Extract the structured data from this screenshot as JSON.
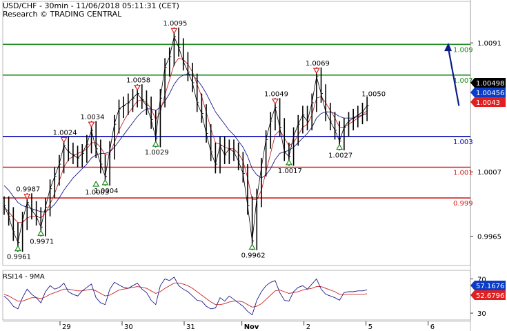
{
  "header": {
    "line1": "USD/CHF - 30min - 11/06/2018 05:11:31 (CET)",
    "line2": "Research © TRADING CENTRAL"
  },
  "rsi_title": "RSI14 - 9MA",
  "colors": {
    "price": "#000000",
    "ma_fast": "#cc2222",
    "ma_slow": "#1a1a8c",
    "resistance": "#1e8c1e",
    "pivot": "#0000b4",
    "support": "#d42020",
    "arrow": "#0a1e8c",
    "peak_marker": "#d42020",
    "trough_marker": "#1e8c1e",
    "tag_black": "#000000",
    "tag_blue": "#0a3cc8",
    "tag_red": "#e02020"
  },
  "chart_data": [
    {
      "type": "line",
      "name": "price",
      "x_ticks": [
        {
          "label": "29",
          "pos": 0.9
        },
        {
          "label": "30",
          "pos": 1.9
        },
        {
          "label": "31",
          "pos": 2.9
        },
        {
          "label": "Nov",
          "pos": 3.83
        },
        {
          "label": "2",
          "pos": 4.83
        },
        {
          "label": "5",
          "pos": 5.83
        },
        {
          "label": "6",
          "pos": 6.83
        }
      ],
      "ylim": [
        0.9946,
        1.0118
      ],
      "y_ticks": [
        "1.0091",
        "1.0007",
        "0.9965"
      ],
      "levels": [
        {
          "label": "1.009",
          "value": 1.009,
          "kind": "resistance"
        },
        {
          "label": "1.007",
          "value": 1.007,
          "kind": "resistance"
        },
        {
          "label": "1.003",
          "value": 1.003,
          "kind": "pivot"
        },
        {
          "label": "1.001",
          "value": 1.001,
          "kind": "support"
        },
        {
          "label": "0.999",
          "value": 0.999,
          "kind": "support"
        }
      ],
      "price_tags": [
        {
          "label": "1.00498",
          "value": 1.00498,
          "style": "black"
        },
        {
          "label": "1.00456",
          "value": 1.00456,
          "style": "blue"
        },
        {
          "label": "1.0043",
          "value": 1.0043,
          "style": "red"
        }
      ],
      "series": {
        "x": [
          0.0,
          0.1,
          0.2,
          0.3,
          0.4,
          0.5,
          0.6,
          0.7,
          0.8,
          0.9,
          1.0,
          1.1,
          1.2,
          1.3,
          1.4,
          1.5,
          1.6,
          1.7,
          1.8,
          1.9,
          2.0,
          2.1,
          2.2,
          2.3,
          2.4,
          2.5,
          2.6,
          2.7,
          2.8,
          2.9,
          3.0,
          3.1,
          3.2,
          3.3,
          3.4,
          3.5,
          3.6,
          3.7,
          3.8,
          3.9,
          4.0,
          4.1,
          4.2,
          4.3,
          4.4,
          4.5,
          4.6,
          4.7,
          4.8,
          4.9,
          5.0,
          5.1,
          5.2,
          5.3,
          5.4,
          5.5,
          5.6,
          5.7,
          5.8,
          5.9,
          6.0,
          6.1,
          6.2,
          6.3,
          6.4,
          6.5,
          6.6,
          6.7,
          6.8,
          6.9,
          7.0,
          7.1,
          7.2,
          7.3,
          7.4,
          7.5,
          7.6,
          7.7,
          7.8,
          7.9,
          8.0,
          8.1,
          8.2,
          8.3,
          8.4,
          8.5,
          8.6,
          8.7,
          8.8,
          8.9,
          9.0,
          9.1,
          9.2,
          9.3,
          9.4,
          9.5,
          9.6,
          9.7,
          9.8,
          9.9
        ],
        "close": [
          0.9985,
          0.9978,
          0.9968,
          0.9961,
          0.9975,
          0.9987,
          0.9982,
          0.9978,
          0.9971,
          0.9984,
          0.9996,
          1.0004,
          1.0012,
          1.0024,
          1.002,
          1.0018,
          1.0016,
          1.0019,
          1.0025,
          1.0034,
          1.0022,
          1.0012,
          1.0004,
          1.0021,
          1.0038,
          1.0048,
          1.005,
          1.0052,
          1.0055,
          1.0058,
          1.0054,
          1.005,
          1.0041,
          1.0029,
          1.0055,
          1.0075,
          1.0082,
          1.0095,
          1.0088,
          1.0079,
          1.0072,
          1.0065,
          1.0052,
          1.0045,
          1.0032,
          1.002,
          1.0012,
          1.0024,
          1.0018,
          1.0022,
          1.002,
          1.0014,
          1.0006,
          0.9985,
          0.9962,
          0.999,
          1.001,
          1.0028,
          1.004,
          1.0049,
          1.0036,
          1.002,
          1.0017,
          1.003,
          1.0038,
          1.0044,
          1.004,
          1.0052,
          1.0069,
          1.0058,
          1.0046,
          1.004,
          1.0034,
          1.0027,
          1.0036,
          1.004,
          1.0042,
          1.0044,
          1.0046,
          1.005
        ],
        "ma_fast": [
          0.9984,
          0.9981,
          0.9977,
          0.9974,
          0.9974,
          0.9977,
          0.9978,
          0.9978,
          0.9977,
          0.998,
          0.9986,
          0.9993,
          1.0001,
          1.001,
          1.0015,
          1.0017,
          1.0019,
          1.002,
          1.0022,
          1.0026,
          1.0026,
          1.0023,
          1.0018,
          1.0019,
          1.0026,
          1.0034,
          1.004,
          1.0045,
          1.0049,
          1.0053,
          1.0054,
          1.0052,
          1.0048,
          1.0041,
          1.0046,
          1.0057,
          1.0067,
          1.0077,
          1.0081,
          1.008,
          1.0077,
          1.0072,
          1.0064,
          1.0056,
          1.0046,
          1.0035,
          1.0026,
          1.0025,
          1.0023,
          1.0022,
          1.0022,
          1.0019,
          1.0014,
          1.0003,
          0.9989,
          0.9989,
          0.9995,
          1.0007,
          1.0019,
          1.0031,
          1.0034,
          1.0029,
          1.0024,
          1.0026,
          1.0031,
          1.0036,
          1.0038,
          1.0044,
          1.0055,
          1.0056,
          1.0052,
          1.0047,
          1.0042,
          1.0036,
          1.0036,
          1.0038,
          1.004,
          1.0042,
          1.0044,
          1.0047
        ],
        "ma_slow": [
          0.9998,
          0.9995,
          0.9991,
          0.9987,
          0.9985,
          0.9984,
          0.9983,
          0.9982,
          0.9981,
          0.9981,
          0.9983,
          0.9986,
          0.999,
          0.9995,
          0.9999,
          1.0003,
          1.0006,
          1.0009,
          1.0012,
          1.0016,
          1.0018,
          1.0019,
          1.0019,
          1.002,
          1.0023,
          1.0027,
          1.0031,
          1.0035,
          1.0039,
          1.0043,
          1.0046,
          1.0048,
          1.0048,
          1.0047,
          1.0049,
          1.0053,
          1.0058,
          1.0064,
          1.0068,
          1.007,
          1.0071,
          1.007,
          1.0067,
          1.0063,
          1.0058,
          1.0052,
          1.0046,
          1.0042,
          1.0038,
          1.0034,
          1.0031,
          1.0027,
          1.0023,
          1.0017,
          1.0009,
          1.0005,
          1.0003,
          1.0005,
          1.0009,
          1.0015,
          1.0019,
          1.002,
          1.0021,
          1.0023,
          1.0026,
          1.0029,
          1.0032,
          1.0036,
          1.0042,
          1.0045,
          1.0046,
          1.0046,
          1.0045,
          1.0043,
          1.0042,
          1.0042,
          1.0042,
          1.0043,
          1.0044,
          1.0045
        ]
      },
      "annotations": [
        {
          "label": "0.9961",
          "x": 0.3,
          "value": 0.9961,
          "kind": "trough"
        },
        {
          "label": "0.9987",
          "x": 0.5,
          "value": 0.9987,
          "kind": "peak"
        },
        {
          "label": "0.9971",
          "x": 0.8,
          "value": 0.9971,
          "kind": "trough"
        },
        {
          "label": "1.0024",
          "x": 1.3,
          "value": 1.0024,
          "kind": "peak"
        },
        {
          "label": "1.0034",
          "x": 1.9,
          "value": 1.0034,
          "kind": "peak"
        },
        {
          "label": "1.0003",
          "x": 2.0,
          "value": 1.0003,
          "kind": "trough"
        },
        {
          "label": "1.0004",
          "x": 2.2,
          "value": 1.0004,
          "kind": "trough"
        },
        {
          "label": "1.0058",
          "x": 2.9,
          "value": 1.0058,
          "kind": "peak"
        },
        {
          "label": "1.0029",
          "x": 3.3,
          "value": 1.0029,
          "kind": "trough"
        },
        {
          "label": "1.0095",
          "x": 3.7,
          "value": 1.0095,
          "kind": "peak"
        },
        {
          "label": "0.9962",
          "x": 5.4,
          "value": 0.9962,
          "kind": "trough"
        },
        {
          "label": "1.0049",
          "x": 5.9,
          "value": 1.0049,
          "kind": "peak"
        },
        {
          "label": "1.0017",
          "x": 6.2,
          "value": 1.0017,
          "kind": "trough"
        },
        {
          "label": "1.0069",
          "x": 6.8,
          "value": 1.0069,
          "kind": "peak"
        },
        {
          "label": "1.0027",
          "x": 7.3,
          "value": 1.0027,
          "kind": "trough"
        },
        {
          "label": "1.0050",
          "x": 7.9,
          "value": 1.005,
          "kind": "note"
        }
      ],
      "projection": {
        "from": 1.005,
        "to": 1.0091
      }
    },
    {
      "type": "line",
      "name": "RSI14 - 9MA",
      "ylim": [
        22,
        80
      ],
      "y_ticks": [
        "70",
        "30"
      ],
      "tags": [
        {
          "label": "57.1676",
          "value": 57.1676,
          "style": "blue"
        },
        {
          "label": "52.6796",
          "value": 52.6796,
          "style": "red"
        }
      ],
      "series": {
        "rsi": [
          50,
          45,
          38,
          35,
          48,
          58,
          52,
          48,
          42,
          55,
          62,
          58,
          60,
          65,
          55,
          52,
          50,
          56,
          60,
          64,
          48,
          42,
          40,
          58,
          66,
          63,
          60,
          59,
          62,
          65,
          58,
          54,
          45,
          40,
          62,
          70,
          68,
          72,
          62,
          58,
          55,
          50,
          45,
          44,
          38,
          35,
          36,
          48,
          44,
          50,
          46,
          42,
          38,
          32,
          28,
          45,
          55,
          62,
          66,
          68,
          54,
          45,
          44,
          55,
          60,
          62,
          58,
          64,
          70,
          58,
          52,
          50,
          48,
          45,
          54,
          55,
          55,
          56,
          56,
          57.1676
        ],
        "ma": [
          52,
          50,
          47,
          44,
          44,
          46,
          48,
          48,
          47,
          49,
          52,
          54,
          56,
          58,
          58,
          57,
          56,
          56,
          57,
          58,
          56,
          53,
          50,
          51,
          54,
          57,
          58,
          59,
          60,
          61,
          60,
          59,
          56,
          53,
          55,
          59,
          62,
          65,
          65,
          64,
          62,
          59,
          55,
          51,
          47,
          43,
          40,
          40,
          41,
          43,
          44,
          44,
          43,
          40,
          37,
          38,
          41,
          46,
          51,
          56,
          57,
          55,
          53,
          54,
          55,
          57,
          58,
          59,
          61,
          61,
          59,
          57,
          55,
          52,
          52,
          52,
          52,
          52,
          52,
          52.6796
        ]
      }
    }
  ]
}
